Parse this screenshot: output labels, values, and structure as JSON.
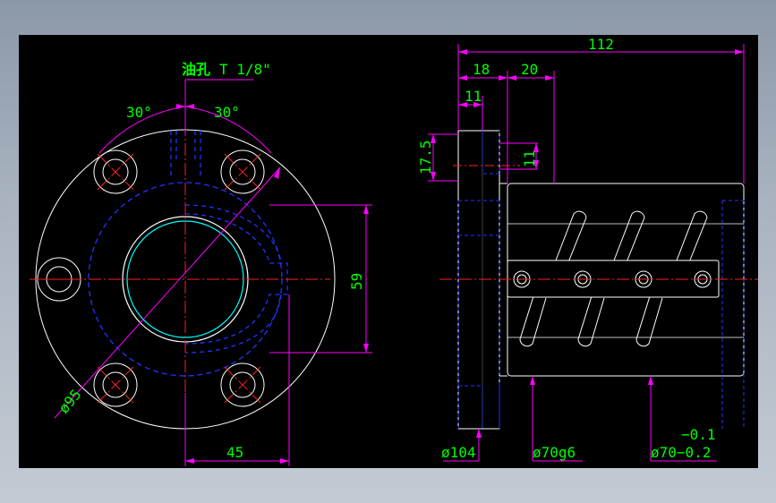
{
  "drawing": {
    "oil_hole_label_cn": "油孔",
    "oil_hole_label_spec": "T 1/8\"",
    "angle_left": "30°",
    "angle_right": "30°",
    "dim_59": "59",
    "dim_45": "45",
    "dim_phi95": "ø95",
    "dim_112": "112",
    "dim_18": "18",
    "dim_20": "20",
    "dim_11_top": "11",
    "dim_11_side": "11",
    "dim_17_5": "17.5",
    "dim_phi104": "ø104",
    "dim_phi70g6": "ø70g6",
    "dim_tol": "−0.1",
    "dim_phi70_tol": "ø70−0.2"
  },
  "colors": {
    "background": "#000000",
    "outline": "#ffffff",
    "dimension": "#ff00ff",
    "dim_text": "#00ff00",
    "hidden": "#0000ff",
    "center": "#ff0000",
    "cyan": "#00ffff",
    "label": "#00ff00"
  }
}
